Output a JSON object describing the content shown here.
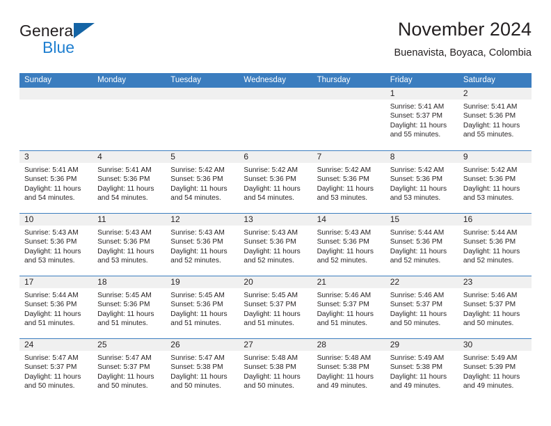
{
  "brand": {
    "name_top": "General",
    "name_bottom": "Blue",
    "triangle_color": "#1464a5",
    "blue_text_color": "#1f7fd0"
  },
  "header": {
    "title": "November 2024",
    "subtitle": "Buenavista, Boyaca, Colombia"
  },
  "theme": {
    "header_blue": "#3b7dbf",
    "day_band_gray": "#f0f0f0",
    "text_color": "#231f20"
  },
  "calendar": {
    "day_names": [
      "Sunday",
      "Monday",
      "Tuesday",
      "Wednesday",
      "Thursday",
      "Friday",
      "Saturday"
    ],
    "weeks": [
      [
        {
          "empty": true
        },
        {
          "empty": true
        },
        {
          "empty": true
        },
        {
          "empty": true
        },
        {
          "empty": true
        },
        {
          "day": "1",
          "sunrise": "Sunrise: 5:41 AM",
          "sunset": "Sunset: 5:37 PM",
          "daylight1": "Daylight: 11 hours",
          "daylight2": "and 55 minutes."
        },
        {
          "day": "2",
          "sunrise": "Sunrise: 5:41 AM",
          "sunset": "Sunset: 5:36 PM",
          "daylight1": "Daylight: 11 hours",
          "daylight2": "and 55 minutes."
        }
      ],
      [
        {
          "day": "3",
          "sunrise": "Sunrise: 5:41 AM",
          "sunset": "Sunset: 5:36 PM",
          "daylight1": "Daylight: 11 hours",
          "daylight2": "and 54 minutes."
        },
        {
          "day": "4",
          "sunrise": "Sunrise: 5:41 AM",
          "sunset": "Sunset: 5:36 PM",
          "daylight1": "Daylight: 11 hours",
          "daylight2": "and 54 minutes."
        },
        {
          "day": "5",
          "sunrise": "Sunrise: 5:42 AM",
          "sunset": "Sunset: 5:36 PM",
          "daylight1": "Daylight: 11 hours",
          "daylight2": "and 54 minutes."
        },
        {
          "day": "6",
          "sunrise": "Sunrise: 5:42 AM",
          "sunset": "Sunset: 5:36 PM",
          "daylight1": "Daylight: 11 hours",
          "daylight2": "and 54 minutes."
        },
        {
          "day": "7",
          "sunrise": "Sunrise: 5:42 AM",
          "sunset": "Sunset: 5:36 PM",
          "daylight1": "Daylight: 11 hours",
          "daylight2": "and 53 minutes."
        },
        {
          "day": "8",
          "sunrise": "Sunrise: 5:42 AM",
          "sunset": "Sunset: 5:36 PM",
          "daylight1": "Daylight: 11 hours",
          "daylight2": "and 53 minutes."
        },
        {
          "day": "9",
          "sunrise": "Sunrise: 5:42 AM",
          "sunset": "Sunset: 5:36 PM",
          "daylight1": "Daylight: 11 hours",
          "daylight2": "and 53 minutes."
        }
      ],
      [
        {
          "day": "10",
          "sunrise": "Sunrise: 5:43 AM",
          "sunset": "Sunset: 5:36 PM",
          "daylight1": "Daylight: 11 hours",
          "daylight2": "and 53 minutes."
        },
        {
          "day": "11",
          "sunrise": "Sunrise: 5:43 AM",
          "sunset": "Sunset: 5:36 PM",
          "daylight1": "Daylight: 11 hours",
          "daylight2": "and 53 minutes."
        },
        {
          "day": "12",
          "sunrise": "Sunrise: 5:43 AM",
          "sunset": "Sunset: 5:36 PM",
          "daylight1": "Daylight: 11 hours",
          "daylight2": "and 52 minutes."
        },
        {
          "day": "13",
          "sunrise": "Sunrise: 5:43 AM",
          "sunset": "Sunset: 5:36 PM",
          "daylight1": "Daylight: 11 hours",
          "daylight2": "and 52 minutes."
        },
        {
          "day": "14",
          "sunrise": "Sunrise: 5:43 AM",
          "sunset": "Sunset: 5:36 PM",
          "daylight1": "Daylight: 11 hours",
          "daylight2": "and 52 minutes."
        },
        {
          "day": "15",
          "sunrise": "Sunrise: 5:44 AM",
          "sunset": "Sunset: 5:36 PM",
          "daylight1": "Daylight: 11 hours",
          "daylight2": "and 52 minutes."
        },
        {
          "day": "16",
          "sunrise": "Sunrise: 5:44 AM",
          "sunset": "Sunset: 5:36 PM",
          "daylight1": "Daylight: 11 hours",
          "daylight2": "and 52 minutes."
        }
      ],
      [
        {
          "day": "17",
          "sunrise": "Sunrise: 5:44 AM",
          "sunset": "Sunset: 5:36 PM",
          "daylight1": "Daylight: 11 hours",
          "daylight2": "and 51 minutes."
        },
        {
          "day": "18",
          "sunrise": "Sunrise: 5:45 AM",
          "sunset": "Sunset: 5:36 PM",
          "daylight1": "Daylight: 11 hours",
          "daylight2": "and 51 minutes."
        },
        {
          "day": "19",
          "sunrise": "Sunrise: 5:45 AM",
          "sunset": "Sunset: 5:36 PM",
          "daylight1": "Daylight: 11 hours",
          "daylight2": "and 51 minutes."
        },
        {
          "day": "20",
          "sunrise": "Sunrise: 5:45 AM",
          "sunset": "Sunset: 5:37 PM",
          "daylight1": "Daylight: 11 hours",
          "daylight2": "and 51 minutes."
        },
        {
          "day": "21",
          "sunrise": "Sunrise: 5:46 AM",
          "sunset": "Sunset: 5:37 PM",
          "daylight1": "Daylight: 11 hours",
          "daylight2": "and 51 minutes."
        },
        {
          "day": "22",
          "sunrise": "Sunrise: 5:46 AM",
          "sunset": "Sunset: 5:37 PM",
          "daylight1": "Daylight: 11 hours",
          "daylight2": "and 50 minutes."
        },
        {
          "day": "23",
          "sunrise": "Sunrise: 5:46 AM",
          "sunset": "Sunset: 5:37 PM",
          "daylight1": "Daylight: 11 hours",
          "daylight2": "and 50 minutes."
        }
      ],
      [
        {
          "day": "24",
          "sunrise": "Sunrise: 5:47 AM",
          "sunset": "Sunset: 5:37 PM",
          "daylight1": "Daylight: 11 hours",
          "daylight2": "and 50 minutes."
        },
        {
          "day": "25",
          "sunrise": "Sunrise: 5:47 AM",
          "sunset": "Sunset: 5:37 PM",
          "daylight1": "Daylight: 11 hours",
          "daylight2": "and 50 minutes."
        },
        {
          "day": "26",
          "sunrise": "Sunrise: 5:47 AM",
          "sunset": "Sunset: 5:38 PM",
          "daylight1": "Daylight: 11 hours",
          "daylight2": "and 50 minutes."
        },
        {
          "day": "27",
          "sunrise": "Sunrise: 5:48 AM",
          "sunset": "Sunset: 5:38 PM",
          "daylight1": "Daylight: 11 hours",
          "daylight2": "and 50 minutes."
        },
        {
          "day": "28",
          "sunrise": "Sunrise: 5:48 AM",
          "sunset": "Sunset: 5:38 PM",
          "daylight1": "Daylight: 11 hours",
          "daylight2": "and 49 minutes."
        },
        {
          "day": "29",
          "sunrise": "Sunrise: 5:49 AM",
          "sunset": "Sunset: 5:38 PM",
          "daylight1": "Daylight: 11 hours",
          "daylight2": "and 49 minutes."
        },
        {
          "day": "30",
          "sunrise": "Sunrise: 5:49 AM",
          "sunset": "Sunset: 5:39 PM",
          "daylight1": "Daylight: 11 hours",
          "daylight2": "and 49 minutes."
        }
      ]
    ]
  }
}
